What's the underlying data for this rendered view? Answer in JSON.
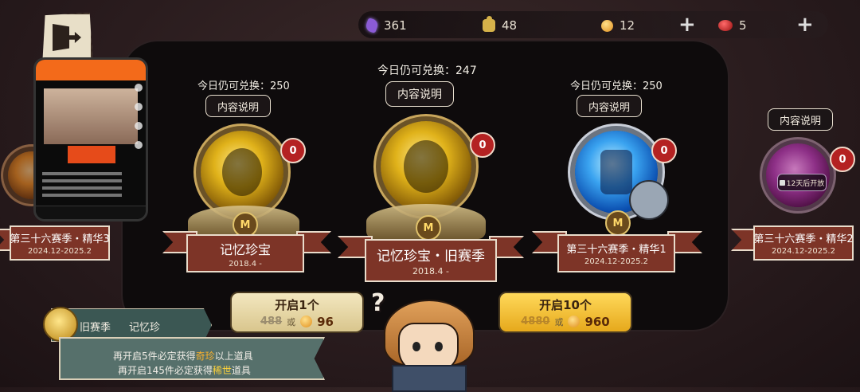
{
  "top_bar": {
    "gems": "361",
    "puzzle": "48",
    "coins": "12",
    "red_orbs": "5"
  },
  "left_side_card": {
    "title": "第三十六赛季・精华3",
    "date": "2024.12-2025.2"
  },
  "cards": [
    {
      "remaining": "今日仍可兑换：250",
      "info": "内容说明",
      "count": "0",
      "title": "记忆珍宝",
      "date": "2018.4 -"
    },
    {
      "remaining": "今日仍可兑换：247",
      "info": "内容说明",
      "count": "0",
      "title": "记忆珍宝・旧赛季",
      "date": "2018.4 -"
    },
    {
      "remaining": "今日仍可兑换：250",
      "info": "内容说明",
      "count": "0",
      "title": "第三十六赛季・精华1",
      "date": "2024.12-2025.2"
    }
  ],
  "right_side_card": {
    "info": "内容说明",
    "count": "0",
    "locked": "12天后开放",
    "title": "第三十六赛季・精华2",
    "date": "2024.12-2025.2"
  },
  "open_one": {
    "label": "开启1个",
    "cost_gem": "488",
    "or": "或",
    "cost_coin": "96"
  },
  "open_ten": {
    "label": "开启10个",
    "cost_gem": "4880",
    "or": "或",
    "cost_coin": "960"
  },
  "banner": {
    "season_a": "旧赛季",
    "season_b": "记忆珍",
    "line1_pre": "再开启5件必定获得",
    "line1_hl": "奇珍",
    "line1_post": "以上道具",
    "line2_pre": "再开启145件必定获得",
    "line2_hl": "稀世",
    "line2_post": "道具"
  },
  "colors": {
    "ribbon": "#7d3427",
    "badge_red": "#b42222",
    "rare_highlight": "#ffb22a",
    "legend_highlight": "#ffd33a"
  }
}
